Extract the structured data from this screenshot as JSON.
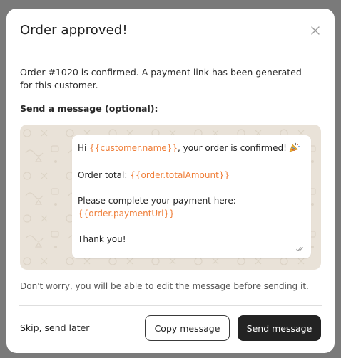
{
  "modal": {
    "title": "Order approved!",
    "description": "Order #1020 is confirmed. A payment link has been generated for this customer.",
    "section_label": "Send a message (optional):",
    "note": "Don't worry, you will be able to edit the message before sending it."
  },
  "message": {
    "line1_prefix": "Hi ",
    "line1_var": "{{customer.name}}",
    "line1_suffix": ", your order is confirmed!",
    "line1_emoji": "party-popper-icon",
    "line2_prefix": "Order total: ",
    "line2_var": "{{order.totalAmount}}",
    "line3": "Please complete your payment here:",
    "line4_var": "{{order.paymentUrl}}",
    "line5": "Thank you!"
  },
  "actions": {
    "skip_label": "Skip, send later",
    "copy_label": "Copy message",
    "send_label": "Send message"
  },
  "colors": {
    "variable": "#ef7f3a",
    "primary_button": "#232323",
    "chat_background": "#e9e2d8"
  }
}
